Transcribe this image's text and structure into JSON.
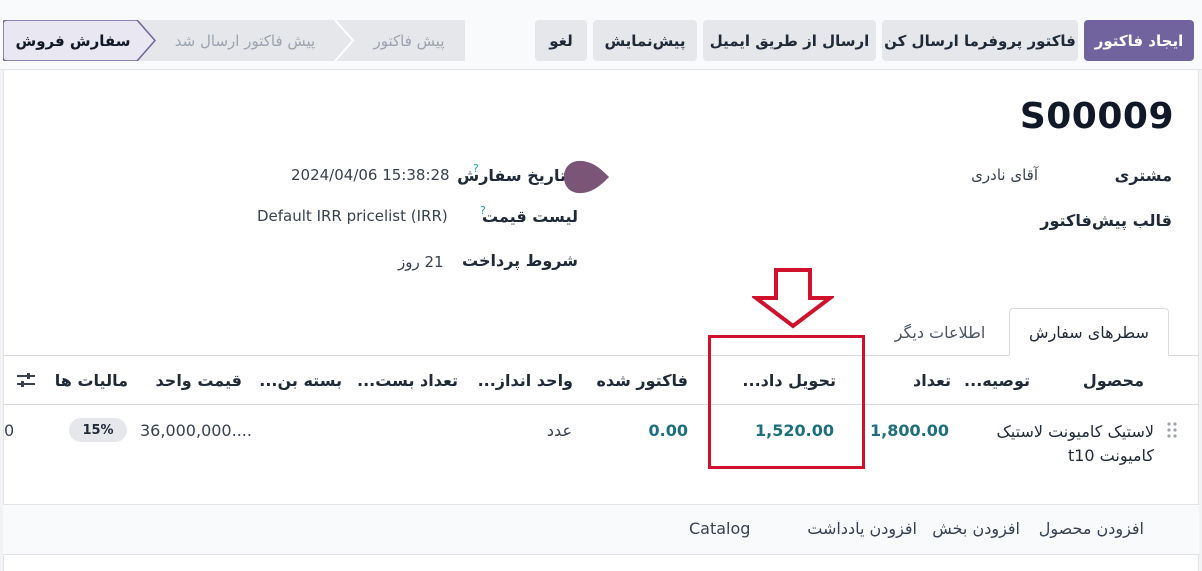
{
  "toolbar": {
    "create_invoice": "ایجاد فاکتور",
    "send_proforma": "فاکتور پروفرما ارسال کن",
    "send_email": "ارسال از طریق ایمیل",
    "preview": "پیش‌نمایش",
    "cancel": "لغو"
  },
  "statusbar": {
    "stages": [
      "پیش فاکتور",
      "پیش فاکتور ارسال شد",
      "سفارش فروش"
    ],
    "active": "سفارش فروش"
  },
  "record": {
    "name": "S00009"
  },
  "fields": {
    "customer_label": "مشتری",
    "customer_value": "آقای نادری",
    "quote_template_label": "قالب پیش‌فاکتور",
    "order_date_label": "تاریخ سفارش",
    "order_date_value": "2024/04/06 15:38:28",
    "pricelist_label": "لیست قیمت",
    "pricelist_value": "Default IRR pricelist (IRR)",
    "payment_terms_label": "شروط پرداخت",
    "payment_terms_value": "21 روز",
    "help_mark": "?"
  },
  "tabs": [
    {
      "label": "سطرهای سفارش",
      "active": true
    },
    {
      "label": "اطلاعات دیگر",
      "active": false
    }
  ],
  "table": {
    "columns": [
      "محصول",
      "توصیه...",
      "تعداد",
      "تحویل داد...",
      "فاکتور شده",
      "واحد انداز...",
      "تعداد بست...",
      "بسته بن...",
      "قیمت واحد",
      "مالیات ها"
    ],
    "rows": [
      {
        "product": "لاستیک کامیونت لاستیک کامیونت t10",
        "quantity": "1,800.00",
        "delivered": "1,520.00",
        "invoiced": "0.00",
        "uom": "عدد",
        "unit_price": "36,000,000....",
        "tax": "15%",
        "subtotal_fragment": "0"
      }
    ],
    "footer_links": [
      "افزودن محصول",
      "افزودن بخش",
      "افزودن یادداشت",
      "Catalog"
    ]
  },
  "colors": {
    "primary": "#71639e",
    "annotation": "#d0112b",
    "numeric": "#1d6f7f"
  }
}
